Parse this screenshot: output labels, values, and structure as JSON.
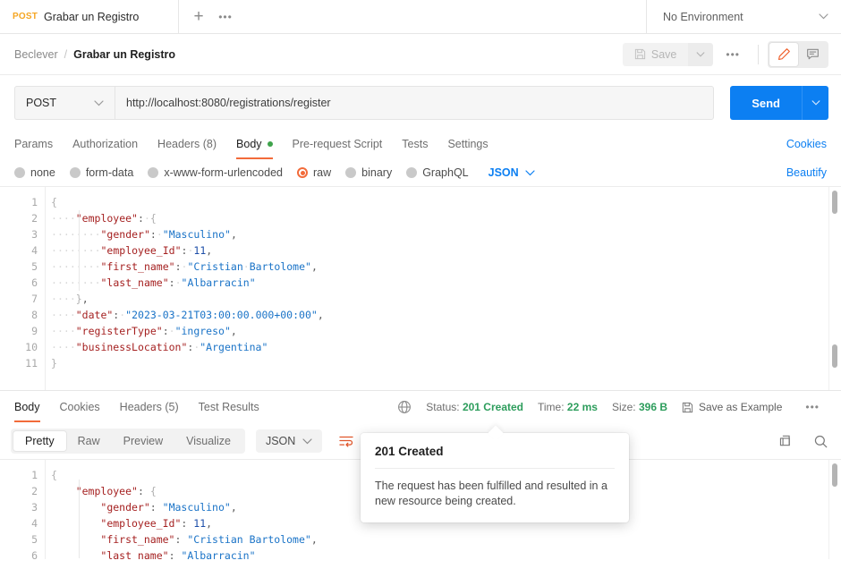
{
  "tabbar": {
    "request_tab": {
      "method": "POST",
      "title": "Grabar un Registro"
    },
    "new_tab_label": "+",
    "tab_more_label": "•••",
    "environment": {
      "selected": "No Environment"
    }
  },
  "header": {
    "breadcrumb_root": "Beclever",
    "breadcrumb_separator": "/",
    "breadcrumb_current": "Grabar un Registro",
    "save_label": "Save",
    "more_label": "•••"
  },
  "url_bar": {
    "method": "POST",
    "url": "http://localhost:8080/registrations/register",
    "send_label": "Send"
  },
  "request_tabs": {
    "items": [
      {
        "label": "Params",
        "active": false
      },
      {
        "label": "Authorization",
        "active": false
      },
      {
        "label": "Headers (8)",
        "active": false
      },
      {
        "label": "Body",
        "active": true
      },
      {
        "label": "Pre-request Script",
        "active": false
      },
      {
        "label": "Tests",
        "active": false
      },
      {
        "label": "Settings",
        "active": false
      }
    ],
    "cookies_link": "Cookies"
  },
  "body_types": {
    "options": [
      {
        "label": "none",
        "selected": false
      },
      {
        "label": "form-data",
        "selected": false
      },
      {
        "label": "x-www-form-urlencoded",
        "selected": false
      },
      {
        "label": "raw",
        "selected": true
      },
      {
        "label": "binary",
        "selected": false
      },
      {
        "label": "GraphQL",
        "selected": false
      }
    ],
    "format": "JSON",
    "beautify_link": "Beautify"
  },
  "request_body": {
    "line_numbers": [
      "1",
      "2",
      "3",
      "4",
      "5",
      "6",
      "7",
      "8",
      "9",
      "10",
      "11"
    ],
    "json": {
      "employee": {
        "gender": "Masculino",
        "employee_Id": 11,
        "first_name": "Cristian Bartolome",
        "last_name": "Albarracin"
      },
      "date": "2023-03-21T03:00:00.000+00:00",
      "registerType": "ingreso",
      "businessLocation": "Argentina"
    }
  },
  "response": {
    "tabs": [
      {
        "label": "Body",
        "active": true
      },
      {
        "label": "Cookies",
        "active": false
      },
      {
        "label": "Headers (5)",
        "active": false
      },
      {
        "label": "Test Results",
        "active": false
      }
    ],
    "status_label": "Status:",
    "status_value": "201 Created",
    "time_label": "Time:",
    "time_value": "22 ms",
    "size_label": "Size:",
    "size_value": "396 B",
    "save_as_example": "Save as Example",
    "more_label": "•••",
    "view_modes": [
      {
        "label": "Pretty",
        "active": true
      },
      {
        "label": "Raw",
        "active": false
      },
      {
        "label": "Preview",
        "active": false
      },
      {
        "label": "Visualize",
        "active": false
      }
    ],
    "format": "JSON",
    "line_numbers": [
      "1",
      "2",
      "3",
      "4",
      "5",
      "6"
    ]
  },
  "tooltip": {
    "title": "201 Created",
    "body": "The request has been fulfilled and resulted in a new resource being created."
  },
  "colors": {
    "accent_orange": "#f26b3a",
    "send_blue": "#0c7ff2",
    "link_blue": "#0c7ff2",
    "status_green": "#2d9d5c",
    "method_post": "#f5a623",
    "json_key": "#a52121",
    "json_string": "#1a73c7",
    "json_number": "#1d4ea8"
  },
  "icons": {
    "plus": "plus-icon",
    "tab_more": "ellipsis-icon",
    "env_chevron": "chevron-down-icon",
    "save_disk": "save-disk-icon",
    "pencil": "pencil-icon",
    "comment": "comment-icon",
    "globe": "globe-icon",
    "copy": "copy-icon",
    "search": "search-icon",
    "wrap_lines": "wrap-lines-icon"
  }
}
